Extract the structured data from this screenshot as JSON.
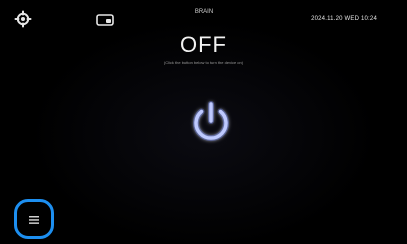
{
  "topbar": {
    "left_icon": "settings-icon",
    "mid_icon": "display-icon",
    "title": "BRAIN",
    "datetime": "2024.11.20 WED 10:24"
  },
  "main": {
    "status": "OFF",
    "hint": "(Click the button below to turn the device on)",
    "power_button_icon": "power-icon",
    "accent_color": "#6f86ff"
  },
  "bottom": {
    "menu_button_icon": "list-icon",
    "highlight_color": "#1d8ff0"
  }
}
